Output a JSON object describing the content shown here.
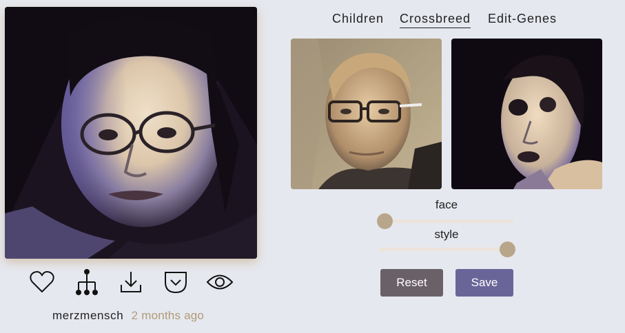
{
  "tabs": [
    {
      "label": "Children",
      "active": false
    },
    {
      "label": "Crossbreed",
      "active": true
    },
    {
      "label": "Edit-Genes",
      "active": false
    }
  ],
  "main_image": {
    "description_icon": "portrait-image"
  },
  "actions": [
    "heart-icon",
    "family-tree-icon",
    "download-icon",
    "chevron-box-icon",
    "eye-icon"
  ],
  "meta": {
    "username": "merzmensch",
    "timestamp": "2 months ago"
  },
  "controls": {
    "face": {
      "label": "face",
      "value": 0.05
    },
    "style": {
      "label": "style",
      "value": 0.95
    }
  },
  "buttons": {
    "reset": "Reset",
    "save": "Save"
  },
  "colors": {
    "background": "#e6e8ef",
    "accent_muted": "#b09a78",
    "slider_thumb": "#b8a68a",
    "reset_bg": "#6a6168",
    "save_bg": "#6a6599"
  }
}
